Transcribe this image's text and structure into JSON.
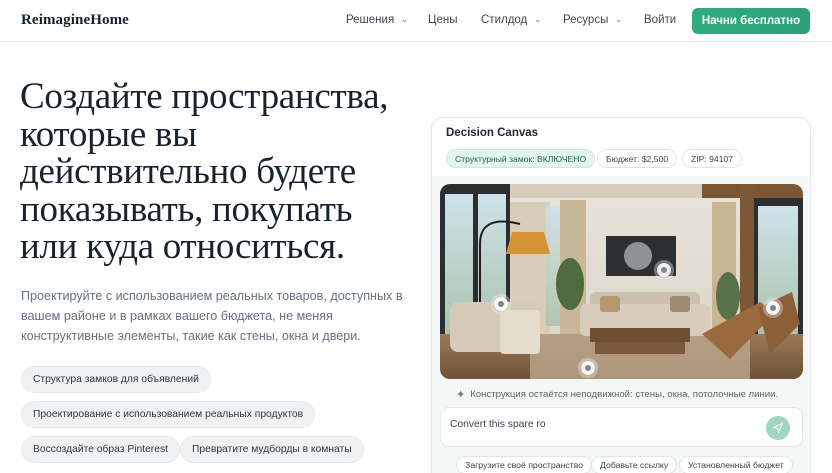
{
  "header": {
    "logo": "ReimagineHome",
    "nav": [
      {
        "label": "Решения",
        "dropdown": true
      },
      {
        "label": "Цены",
        "dropdown": false
      },
      {
        "label": "Стилдод",
        "dropdown": true
      },
      {
        "label": "Ресурсы",
        "dropdown": true
      },
      {
        "label": "Войти",
        "dropdown": false
      }
    ],
    "cta": "Начни бесплатно"
  },
  "hero": {
    "title_lines": [
      "Создайте пространства,",
      "которые вы",
      "действительно будете",
      "показывать, покупать",
      "или куда относиться."
    ],
    "subtitle": "Проектируйте с использованием реальных товаров, доступных в вашем районе и в рамках вашего бюджета, не меняя конструктивные элементы, такие как стены, окна и двери.",
    "pills": [
      "Структура замков для объявлений",
      "Проектирование с использованием реальных продуктов",
      "Воссоздайте образ Pinterest",
      "Превратите мудборды в комнаты"
    ]
  },
  "canvas": {
    "title": "Decision Canvas",
    "chips": [
      "Структурный замок: ВКЛЮЧЕНО",
      "Бюджет: $2,500",
      "ZIP: 94107"
    ],
    "note": "Конструкция остаётся неподвижной: стены, окна, потолочные линии.",
    "prompt": {
      "value": "Convert this spare ro",
      "placeholder": "Convert this spare room"
    },
    "actions": [
      "Загрузите своё пространство",
      "Добавьте ссылку",
      "Установленный бюджет"
    ]
  },
  "colors": {
    "accent": "#2fab7c",
    "ink": "#16222d",
    "muted": "#667080"
  }
}
